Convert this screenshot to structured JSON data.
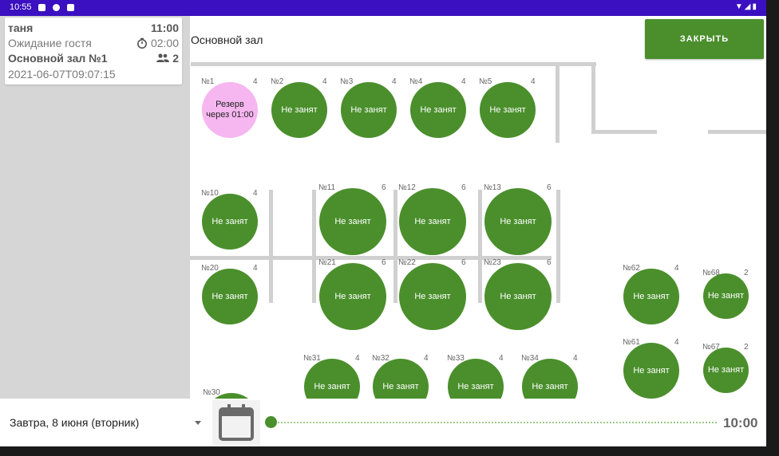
{
  "status_bar": {
    "time": "10:55"
  },
  "guest_card": {
    "name": "таня",
    "time": "11:00",
    "status": "Ожидание гостя",
    "timer": "02:00",
    "hall_table": "Основной зал №1",
    "guests": "2",
    "datetime": "2021-06-07T09:07:15"
  },
  "header": {
    "hall_name": "Основной зал",
    "close_label": "ЗАКРЫТЬ"
  },
  "tables": [
    {
      "num": "№1",
      "cap": "4",
      "status": "Резерв через 01:00",
      "reserved": true
    },
    {
      "num": "№2",
      "cap": "4",
      "status": "Не занят"
    },
    {
      "num": "№3",
      "cap": "4",
      "status": "Не занят"
    },
    {
      "num": "№4",
      "cap": "4",
      "status": "Не занят"
    },
    {
      "num": "№5",
      "cap": "4",
      "status": "Не занят"
    },
    {
      "num": "№10",
      "cap": "4",
      "status": "Не занят"
    },
    {
      "num": "№11",
      "cap": "6",
      "status": "Не занят"
    },
    {
      "num": "№12",
      "cap": "6",
      "status": "Не занят"
    },
    {
      "num": "№13",
      "cap": "6",
      "status": "Не занят"
    },
    {
      "num": "№20",
      "cap": "4",
      "status": "Не занят"
    },
    {
      "num": "№21",
      "cap": "6",
      "status": "Не занят"
    },
    {
      "num": "№22",
      "cap": "6",
      "status": "Не занят"
    },
    {
      "num": "№23",
      "cap": "6",
      "status": "Не занят"
    },
    {
      "num": "№62",
      "cap": "4",
      "status": "Не занят"
    },
    {
      "num": "№68",
      "cap": "2",
      "status": "Не занят"
    },
    {
      "num": "№61",
      "cap": "4",
      "status": "Не занят"
    },
    {
      "num": "№67",
      "cap": "2",
      "status": "Не занят"
    },
    {
      "num": "№31",
      "cap": "4",
      "status": "Не занят"
    },
    {
      "num": "№32",
      "cap": "4",
      "status": "Не занят"
    },
    {
      "num": "№33",
      "cap": "4",
      "status": "Не занят"
    },
    {
      "num": "№34",
      "cap": "4",
      "status": "Не занят"
    },
    {
      "num": "№30",
      "cap": "",
      "status": ""
    }
  ],
  "bottom_bar": {
    "date": "Завтра, 8 июня (вторник)",
    "time": "10:00",
    "calendar_icon": "calendar-icon",
    "slider_position": 0
  },
  "colors": {
    "status_bar": "#3a10c0",
    "accent_green": "#4a8f2c",
    "reserved_pink": "#f6b6f0"
  }
}
